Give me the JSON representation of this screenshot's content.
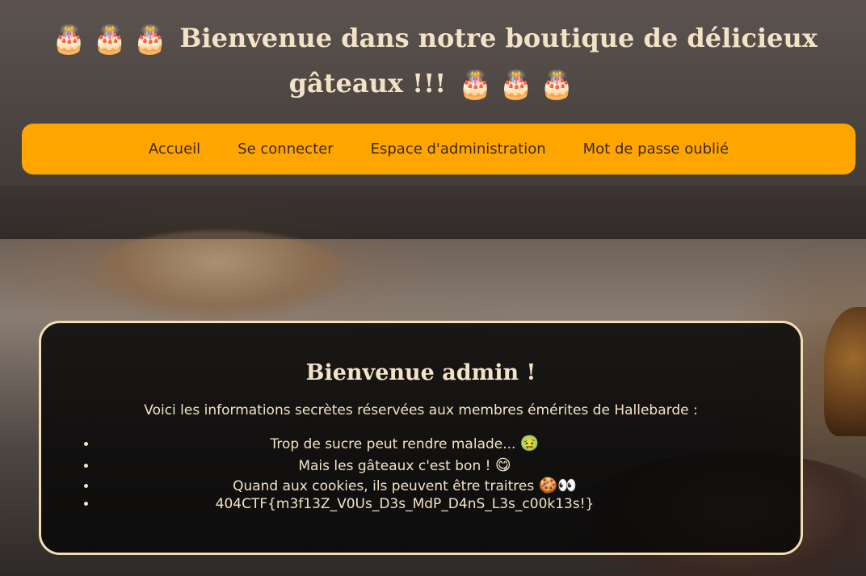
{
  "header": {
    "title": "Bienvenue dans notre boutique de délicieux gâteaux !!!",
    "decoration_icon": "🎂",
    "decoration_icon_name": "birthday-cake-icon"
  },
  "nav": {
    "items": [
      {
        "label": "Accueil"
      },
      {
        "label": "Se connecter"
      },
      {
        "label": "Espace d'administration"
      },
      {
        "label": "Mot de passe oublié"
      }
    ],
    "background_color": "#ffa500"
  },
  "card": {
    "heading": "Bienvenue admin !",
    "intro": "Voici les informations secrètes réservées aux membres émérites de Hallebarde :",
    "items": [
      {
        "text": "Trop de sucre peut rendre malade...",
        "emoji": "🤢"
      },
      {
        "text": "Mais les gâteaux c'est bon !",
        "emoji": "😋"
      },
      {
        "text": "Quand aux cookies, ils peuvent être traitres",
        "emoji": "🍪👀"
      },
      {
        "text": "404CTF{m3f13Z_V0Us_D3s_MdP_D4nS_L3s_c00k13s!}",
        "emoji": ""
      }
    ],
    "border_color": "#f3deb3"
  }
}
